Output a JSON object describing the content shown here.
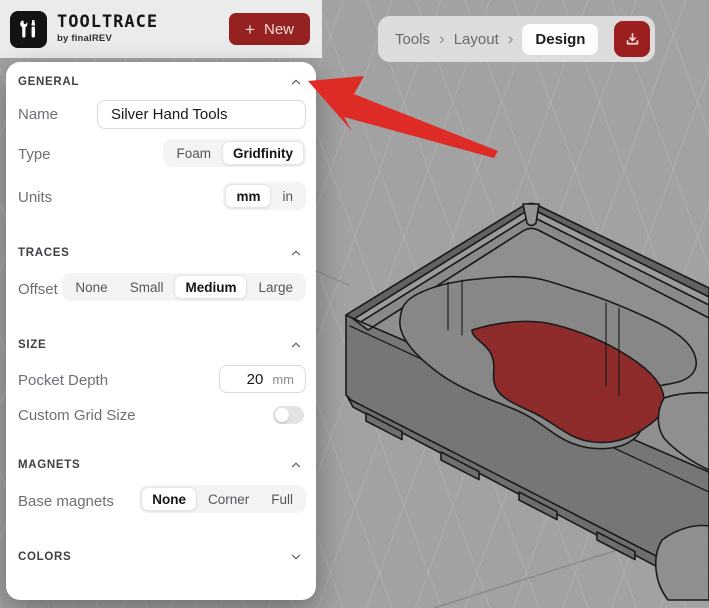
{
  "header": {
    "logo_title": "TOOLTRACE",
    "logo_subtitle": "by finalREV",
    "new_button_plus": "+",
    "new_button_label": "New"
  },
  "breadcrumb": {
    "items": [
      "Tools",
      "Layout",
      "Design"
    ],
    "separator": "›",
    "active": "Design"
  },
  "panel": {
    "sections": {
      "general": {
        "title": "GENERAL",
        "collapsed": false,
        "name_label": "Name",
        "name_value": "Silver Hand Tools",
        "type_label": "Type",
        "type_options": [
          "Foam",
          "Gridfinity"
        ],
        "type_selected": "Gridfinity",
        "units_label": "Units",
        "units_options": [
          "mm",
          "in"
        ],
        "units_selected": "mm"
      },
      "traces": {
        "title": "TRACES",
        "collapsed": false,
        "offset_label": "Offset",
        "offset_options": [
          "None",
          "Small",
          "Medium",
          "Large"
        ],
        "offset_selected": "Medium"
      },
      "size": {
        "title": "SIZE",
        "collapsed": false,
        "pocket_depth_label": "Pocket Depth",
        "pocket_depth_value": "20",
        "pocket_depth_unit": "mm",
        "custom_grid_label": "Custom Grid Size",
        "custom_grid_enabled": false
      },
      "magnets": {
        "title": "MAGNETS",
        "collapsed": false,
        "base_magnets_label": "Base magnets",
        "base_magnets_options": [
          "None",
          "Corner",
          "Full"
        ],
        "base_magnets_selected": "None"
      },
      "colors": {
        "title": "COLORS",
        "collapsed": true
      }
    }
  },
  "icons": {
    "logo": "tools-icon",
    "new_button": "plus-icon",
    "download": "download-icon",
    "section_expanded": "chevron-up-icon",
    "section_collapsed": "chevron-down-icon",
    "custom_grid": "switch-off"
  },
  "colors": {
    "accent_red": "#9b1f1f",
    "arrow_red": "#df2b26",
    "pocket_floor_red": "#8e2b2b",
    "viewport_gray": "#a2a2a2",
    "model_gray": "#8d8d8d"
  }
}
